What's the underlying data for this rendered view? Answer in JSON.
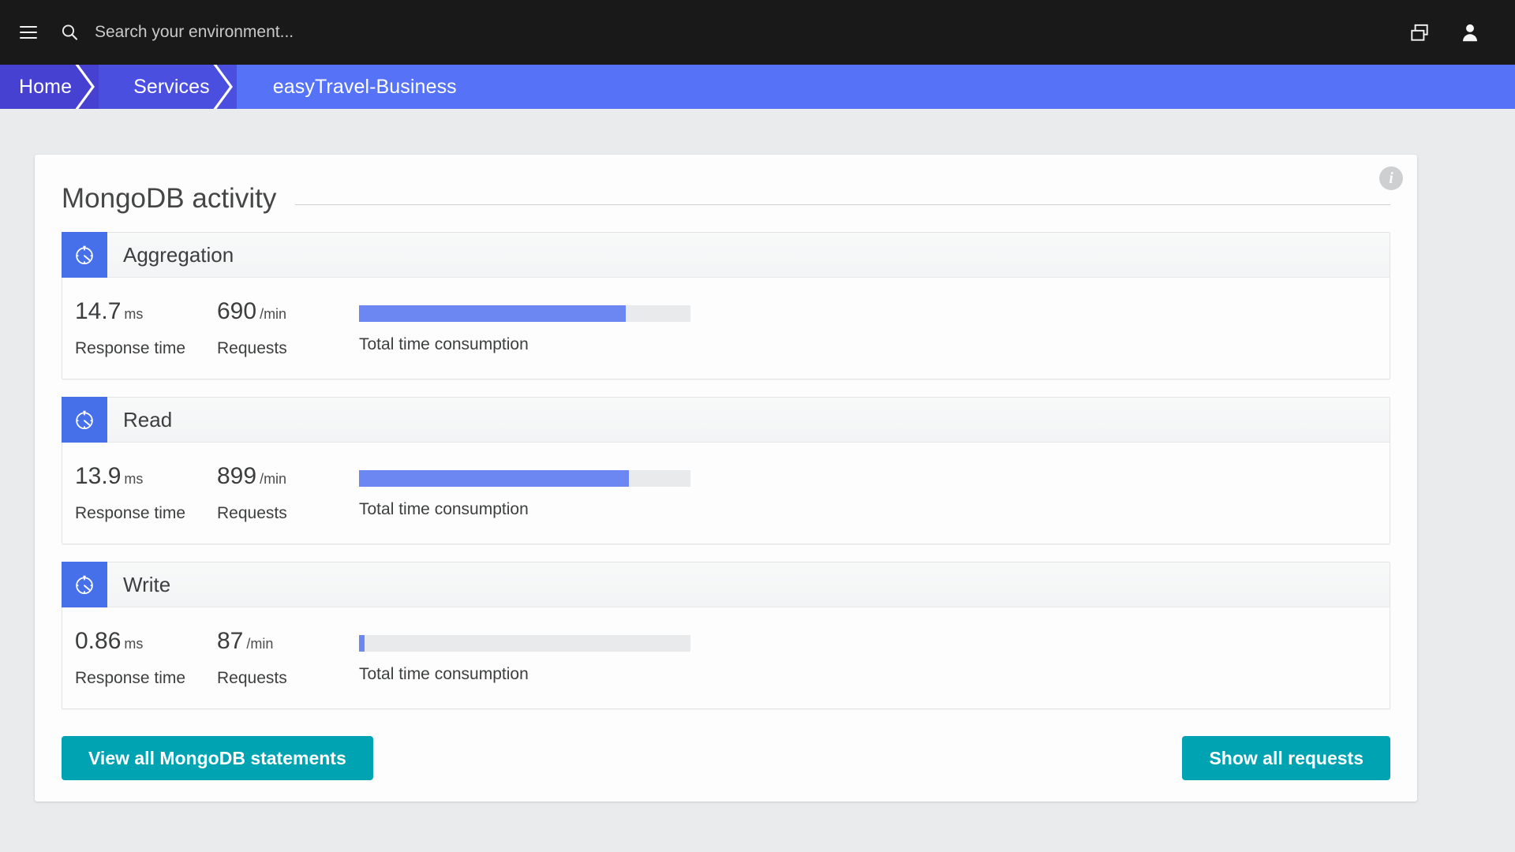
{
  "topbar": {
    "menu_icon": "hamburger-icon",
    "search_icon": "search-icon",
    "search_placeholder": "Search your environment...",
    "search_value": "",
    "window_icon": "windows-copy-icon",
    "user_icon": "user-avatar-icon"
  },
  "breadcrumb": {
    "items": [
      {
        "label": "Home"
      },
      {
        "label": "Services"
      },
      {
        "label": "easyTravel-Business"
      }
    ]
  },
  "card": {
    "title": "MongoDB activity",
    "info_icon": "info-icon",
    "sections": [
      {
        "name": "Aggregation",
        "icon": "stopwatch-icon",
        "response_time": "14.7",
        "response_time_unit": "ms",
        "response_time_label": "Response time",
        "requests": "690",
        "requests_unit": "/min",
        "requests_label": "Requests",
        "bar_label": "Total time consumption",
        "bar_percent": 80.5
      },
      {
        "name": "Read",
        "icon": "stopwatch-icon",
        "response_time": "13.9",
        "response_time_unit": "ms",
        "response_time_label": "Response time",
        "requests": "899",
        "requests_unit": "/min",
        "requests_label": "Requests",
        "bar_label": "Total time consumption",
        "bar_percent": 81.5
      },
      {
        "name": "Write",
        "icon": "stopwatch-icon",
        "response_time": "0.86",
        "response_time_unit": "ms",
        "response_time_label": "Response time",
        "requests": "87",
        "requests_unit": "/min",
        "requests_label": "Requests",
        "bar_label": "Total time consumption",
        "bar_percent": 1.7
      }
    ],
    "footer": {
      "left_button": "View all MongoDB statements",
      "right_button": "Show all requests"
    }
  },
  "colors": {
    "topbar_bg": "#191919",
    "breadcrumb_active": "#5672f6",
    "accent_blue": "#4670ea",
    "bar_fill": "#6c86f2",
    "bar_track": "#e9eaeb",
    "button_teal": "#00a3b1",
    "page_bg": "#e9ebed"
  }
}
